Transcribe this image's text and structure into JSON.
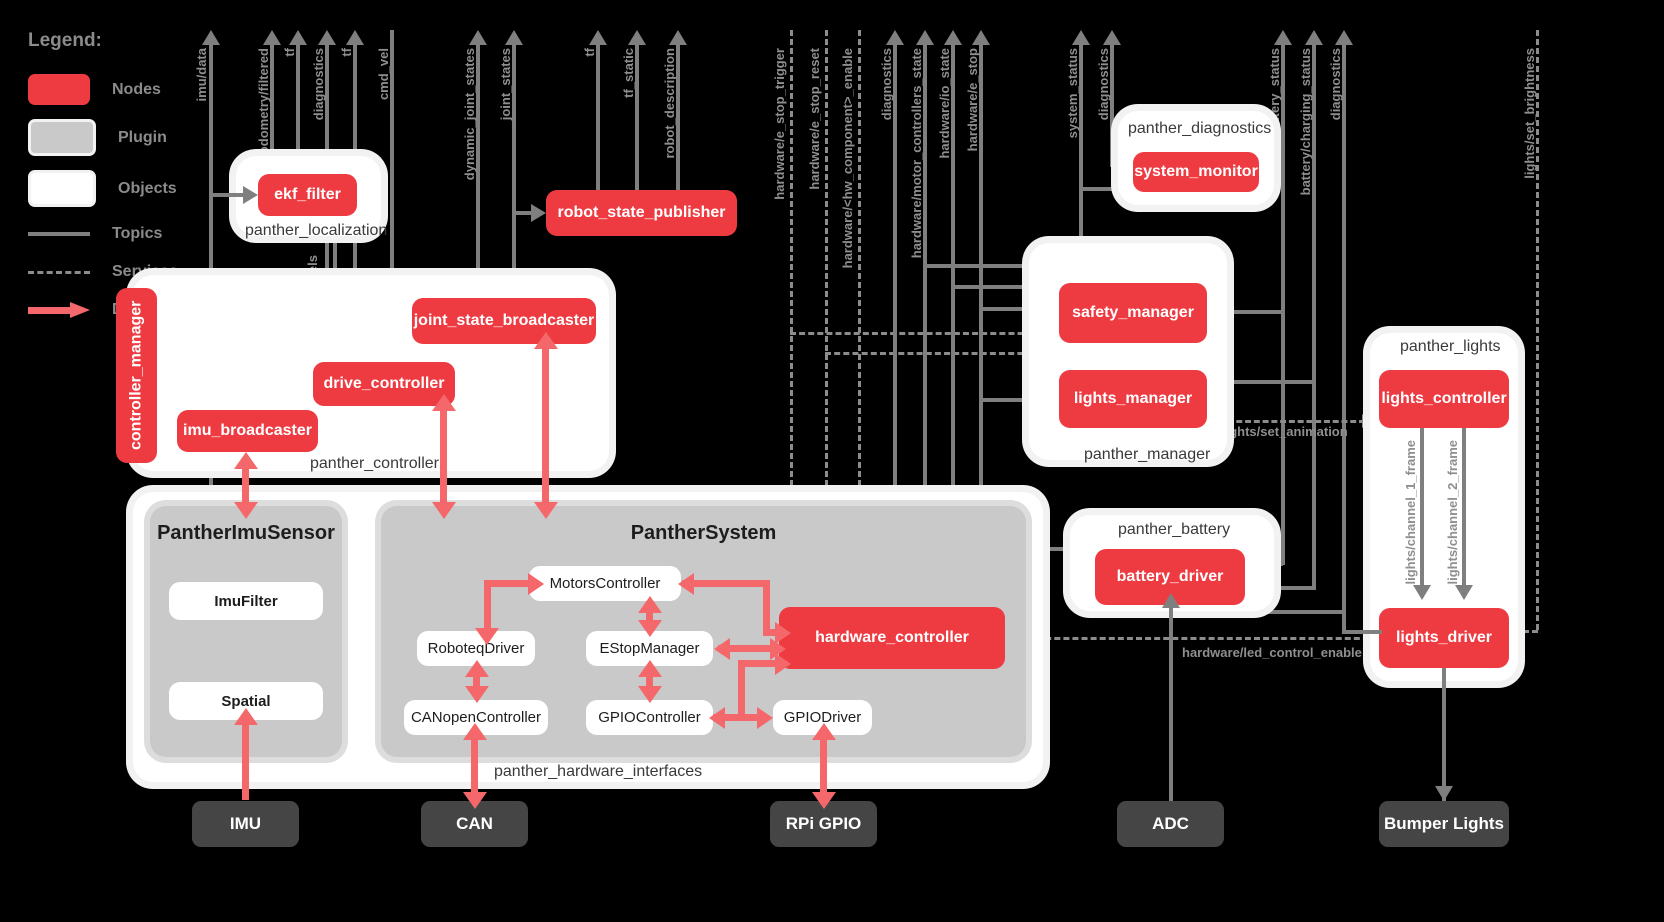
{
  "legend": {
    "title": "Legend:",
    "items": [
      {
        "key": "nodes",
        "label": "Nodes"
      },
      {
        "key": "plugin",
        "label": "Plugin"
      },
      {
        "key": "objects",
        "label": "Objects"
      },
      {
        "key": "topics",
        "label": "Topics"
      },
      {
        "key": "services",
        "label": "Services"
      },
      {
        "key": "data_transfer",
        "label": "Data Transfer"
      }
    ]
  },
  "colors": {
    "node": "#ee3b42",
    "plugin": "#c9c9c9",
    "object": "#ffffff",
    "topic_line": "#7f7f7f",
    "service_line": "#8c8c8c",
    "data_transfer": "#f4686b",
    "hardware": "#454545",
    "background": "#000000"
  },
  "packages": {
    "panther_localization": "panther_localization",
    "panther_controller": "panther_controller",
    "panther_hardware_interfaces": "panther_hardware_interfaces",
    "panther_diagnostics": "panther_diagnostics",
    "panther_manager": "panther_manager",
    "panther_battery": "panther_battery",
    "panther_lights": "panther_lights"
  },
  "plugins": {
    "imu_sensor": "PantherImuSensor",
    "panther_system": "PantherSystem"
  },
  "nodes": {
    "ekf_filter": "ekf_filter",
    "robot_state_publisher": "robot_state_publisher",
    "controller_manager": "controller_manager",
    "joint_state_broadcaster": "joint_state_broadcaster",
    "drive_controller": "drive_controller",
    "imu_broadcaster": "imu_broadcaster",
    "hardware_controller": "hardware_controller",
    "system_monitor": "system_monitor",
    "safety_manager": "safety_manager",
    "lights_manager": "lights_manager",
    "battery_driver": "battery_driver",
    "lights_controller": "lights_controller",
    "lights_driver": "lights_driver"
  },
  "objects": {
    "imu_filter": "ImuFilter",
    "spatial": "Spatial",
    "motors_controller": "MotorsController",
    "roboteq_driver": "RoboteqDriver",
    "canopen_controller": "CANopenController",
    "estop_manager": "EStopManager",
    "gpio_controller": "GPIOController",
    "gpio_driver": "GPIODriver"
  },
  "hardware": {
    "imu": "IMU",
    "can": "CAN",
    "rpi_gpio": "RPi GPIO",
    "adc": "ADC",
    "bumper_lights": "Bumper Lights"
  },
  "topics": {
    "imu_data": "imu/data",
    "odometry_filtered": "odometry/filtered",
    "tf_1": "tf",
    "diagnostics_1": "diagnostics",
    "tf_2": "tf",
    "cmd_vel": "cmd_vel",
    "odometry_wheels": "odometry/wheels",
    "dynamic_joint_states": "dynamic_joint_states",
    "joint_states": "joint_states",
    "tf_3": "tf",
    "tf_static": "tf_static",
    "robot_description": "robot_description",
    "diagnostics_2": "diagnostics",
    "motor_controllers_state": "hardware/motor_controllers_state",
    "io_state": "hardware/io_state",
    "e_stop": "hardware/e_stop",
    "system_status": "system_status",
    "diagnostics_3": "diagnostics",
    "battery_status": "battery/battery_status",
    "charging_status": "battery/charging_status",
    "diagnostics_4": "diagnostics",
    "channel_1_frame": "lights/channel_1_frame",
    "channel_2_frame": "lights/channel_2_frame"
  },
  "services": {
    "e_stop_trigger": "hardware/e_stop_trigger",
    "e_stop_reset": "hardware/e_stop_reset",
    "hw_component_enable": "hardware/<hw_component>_enable",
    "set_animation": "lights/set_animation",
    "led_control_enable": "hardware/led_control_enable",
    "set_brightness": "lights/set_brightness"
  }
}
